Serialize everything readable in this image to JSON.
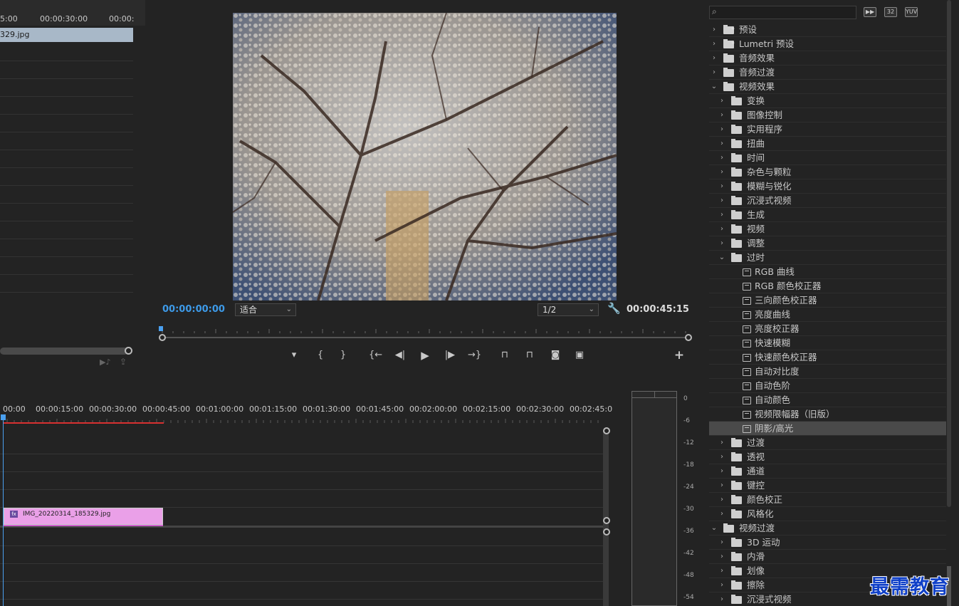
{
  "source_panel": {
    "ruler_labels": [
      "5:00",
      "00:00:30:00",
      "00:00:"
    ],
    "clip_name": "329.jpg"
  },
  "program_monitor": {
    "current_timecode": "00:00:00:00",
    "duration_timecode": "00:00:45:15",
    "zoom_select": "适合",
    "resolution_select": "1/2",
    "controls": [
      {
        "name": "add-marker-button",
        "glyph": "▾"
      },
      {
        "name": "mark-in-button",
        "glyph": "{"
      },
      {
        "name": "mark-out-button",
        "glyph": "}"
      },
      {
        "name": "go-to-in-button",
        "glyph": "{←"
      },
      {
        "name": "step-back-button",
        "glyph": "◀|"
      },
      {
        "name": "play-button",
        "glyph": "▶"
      },
      {
        "name": "step-forward-button",
        "glyph": "|▶"
      },
      {
        "name": "go-to-out-button",
        "glyph": "→}"
      },
      {
        "name": "lift-button",
        "glyph": "⊓"
      },
      {
        "name": "extract-button",
        "glyph": "⊓"
      },
      {
        "name": "export-frame-button",
        "glyph": "◙"
      },
      {
        "name": "comparison-view-button",
        "glyph": "▣"
      }
    ],
    "add_button": "+"
  },
  "timeline": {
    "ruler_labels": [
      "00:00",
      "00:00:15:00",
      "00:00:30:00",
      "00:00:45:00",
      "00:01:00:00",
      "00:01:15:00",
      "00:01:30:00",
      "00:01:45:00",
      "00:02:00:00",
      "00:02:15:00",
      "00:02:30:00",
      "00:02:45:0"
    ],
    "clip_name": "IMG_20220314_185329.jpg",
    "clip_fx": "fx"
  },
  "audio_meter": {
    "db_labels": [
      "0",
      "-6",
      "-12",
      "-18",
      "-24",
      "-30",
      "-36",
      "-42",
      "-48",
      "-54"
    ]
  },
  "effects_panel": {
    "search_icon": "search-icon",
    "toolbar": [
      "32-bit-icon",
      "32",
      "YUV"
    ],
    "items": [
      {
        "label": "预设",
        "level": 0,
        "type": "preset-folder",
        "expanded": false
      },
      {
        "label": "Lumetri 预设",
        "level": 0,
        "type": "preset-folder",
        "expanded": false
      },
      {
        "label": "音频效果",
        "level": 0,
        "type": "folder",
        "expanded": false
      },
      {
        "label": "音频过渡",
        "level": 0,
        "type": "folder",
        "expanded": false
      },
      {
        "label": "视频效果",
        "level": 0,
        "type": "folder",
        "expanded": true
      },
      {
        "label": "变换",
        "level": 1,
        "type": "folder",
        "expanded": false
      },
      {
        "label": "图像控制",
        "level": 1,
        "type": "folder",
        "expanded": false
      },
      {
        "label": "实用程序",
        "level": 1,
        "type": "folder",
        "expanded": false
      },
      {
        "label": "扭曲",
        "level": 1,
        "type": "folder",
        "expanded": false
      },
      {
        "label": "时间",
        "level": 1,
        "type": "folder",
        "expanded": false
      },
      {
        "label": "杂色与颗粒",
        "level": 1,
        "type": "folder",
        "expanded": false
      },
      {
        "label": "模糊与锐化",
        "level": 1,
        "type": "folder",
        "expanded": false
      },
      {
        "label": "沉浸式视频",
        "level": 1,
        "type": "folder",
        "expanded": false
      },
      {
        "label": "生成",
        "level": 1,
        "type": "folder",
        "expanded": false
      },
      {
        "label": "视频",
        "level": 1,
        "type": "folder",
        "expanded": false
      },
      {
        "label": "调整",
        "level": 1,
        "type": "folder",
        "expanded": false
      },
      {
        "label": "过时",
        "level": 1,
        "type": "folder",
        "expanded": true
      },
      {
        "label": "RGB 曲线",
        "level": 2,
        "type": "effect"
      },
      {
        "label": "RGB 颜色校正器",
        "level": 2,
        "type": "effect"
      },
      {
        "label": "三向颜色校正器",
        "level": 2,
        "type": "effect"
      },
      {
        "label": "亮度曲线",
        "level": 2,
        "type": "effect"
      },
      {
        "label": "亮度校正器",
        "level": 2,
        "type": "effect"
      },
      {
        "label": "快速模糊",
        "level": 2,
        "type": "effect"
      },
      {
        "label": "快速颜色校正器",
        "level": 2,
        "type": "effect"
      },
      {
        "label": "自动对比度",
        "level": 2,
        "type": "effect"
      },
      {
        "label": "自动色阶",
        "level": 2,
        "type": "effect"
      },
      {
        "label": "自动颜色",
        "level": 2,
        "type": "effect"
      },
      {
        "label": "视频限幅器（旧版）",
        "level": 2,
        "type": "effect"
      },
      {
        "label": "阴影/高光",
        "level": 2,
        "type": "effect",
        "selected": true
      },
      {
        "label": "过渡",
        "level": 1,
        "type": "folder",
        "expanded": false
      },
      {
        "label": "透视",
        "level": 1,
        "type": "folder",
        "expanded": false
      },
      {
        "label": "通道",
        "level": 1,
        "type": "folder",
        "expanded": false
      },
      {
        "label": "键控",
        "level": 1,
        "type": "folder",
        "expanded": false
      },
      {
        "label": "颜色校正",
        "level": 1,
        "type": "folder",
        "expanded": false
      },
      {
        "label": "风格化",
        "level": 1,
        "type": "folder",
        "expanded": false
      },
      {
        "label": "视频过渡",
        "level": 0,
        "type": "folder",
        "expanded": true
      },
      {
        "label": "3D 运动",
        "level": 1,
        "type": "folder",
        "expanded": false
      },
      {
        "label": "内滑",
        "level": 1,
        "type": "folder",
        "expanded": false
      },
      {
        "label": "划像",
        "level": 1,
        "type": "folder",
        "expanded": false
      },
      {
        "label": "擦除",
        "level": 1,
        "type": "folder",
        "expanded": false
      },
      {
        "label": "沉浸式视频",
        "level": 1,
        "type": "folder",
        "expanded": false
      }
    ]
  },
  "watermark": "最需教育",
  "colors": {
    "timecode_blue": "#3d9ae8",
    "clip_pink": "#eaa0e8",
    "in_out_red": "#d83030"
  }
}
